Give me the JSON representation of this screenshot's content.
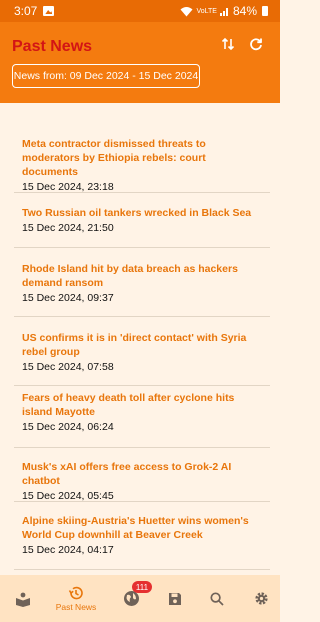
{
  "status_bar": {
    "time": "3:07",
    "network": "VoLTE",
    "battery": "84%"
  },
  "app_bar": {
    "title": "Past News",
    "range_label": "News from: 09 Dec 2024 - 15 Dec 2024"
  },
  "news": [
    {
      "headline": "Meta contractor dismissed threats to moderators by Ethiopia rebels: court documents",
      "date": "15 Dec 2024, 23:18"
    },
    {
      "headline": "Two Russian oil tankers wrecked in Black Sea",
      "date": "15 Dec 2024, 21:50"
    },
    {
      "headline": "Rhode Island hit by data breach as hackers demand ransom",
      "date": "15 Dec 2024, 09:37"
    },
    {
      "headline": "US confirms it is in 'direct contact' with Syria rebel group",
      "date": "15 Dec 2024, 07:58"
    },
    {
      "headline": "Fears of heavy death toll after cyclone hits island Mayotte",
      "date": "15 Dec 2024, 06:24"
    },
    {
      "headline": "Musk's xAI offers free access to Grok-2 AI chatbot",
      "date": "15 Dec 2024, 05:45"
    },
    {
      "headline": "Alpine skiing-Austria's Huetter wins women's World Cup downhill at Beaver Creek",
      "date": "15 Dec 2024, 04:17"
    }
  ],
  "bottom_nav": {
    "active_label": "Past News",
    "badge_count": "111"
  },
  "colors": {
    "appbar": "#f47b0f",
    "status_bar": "#e86b05",
    "title": "#d31515",
    "headline": "#e8760c",
    "background": "#fff3e6",
    "nav": "#ffe3c2",
    "badge": "#e53030"
  }
}
